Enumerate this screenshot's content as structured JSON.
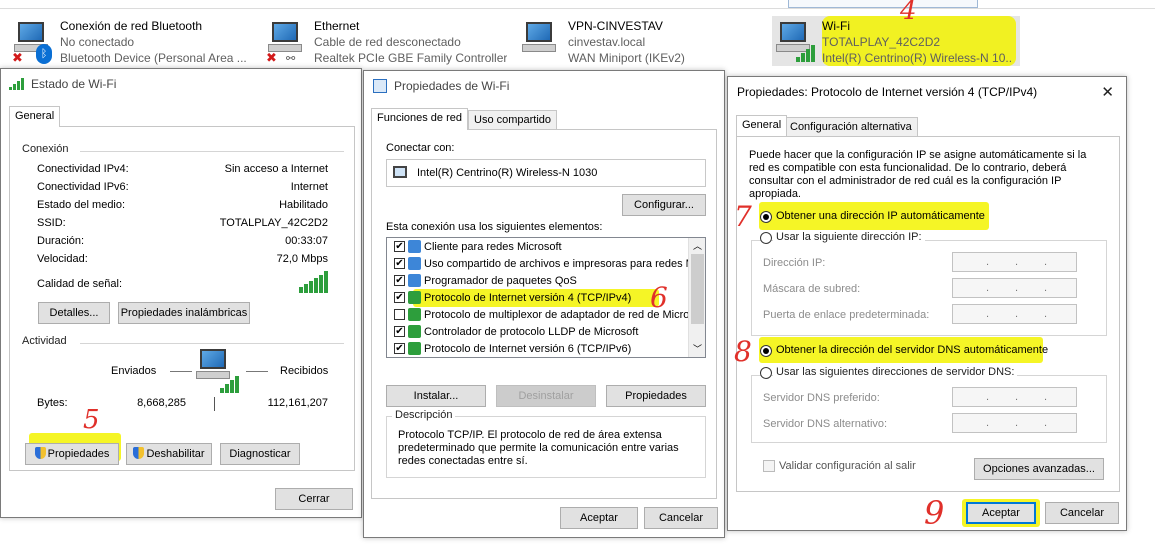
{
  "network_bar": [
    {
      "name": "Conexión de red Bluetooth",
      "line2": "No conectado",
      "line3": "Bluetooth Device (Personal Area ..."
    },
    {
      "name": "Ethernet",
      "line2": "Cable de red desconectado",
      "line3": "Realtek PCIe GBE Family Controller"
    },
    {
      "name": "VPN-CINVESTAV",
      "line2": "cinvestav.local",
      "line3": "WAN Miniport (IKEv2)"
    },
    {
      "name": "Wi-Fi",
      "line2": "TOTALPLAY_42C2D2",
      "line3": "Intel(R) Centrino(R) Wireless-N 10..."
    }
  ],
  "status_window": {
    "title": "Estado de Wi-Fi",
    "tab": "General",
    "connection_label": "Conexión",
    "rows": [
      {
        "label": "Conectividad IPv4:",
        "value": "Sin acceso a Internet"
      },
      {
        "label": "Conectividad IPv6:",
        "value": "Internet"
      },
      {
        "label": "Estado del medio:",
        "value": "Habilitado"
      },
      {
        "label": "SSID:",
        "value": "TOTALPLAY_42C2D2"
      },
      {
        "label": "Duración:",
        "value": "00:33:07"
      },
      {
        "label": "Velocidad:",
        "value": "72,0 Mbps"
      }
    ],
    "signal_label": "Calidad de señal:",
    "details_btn": "Detalles...",
    "wireless_btn": "Propiedades inalámbricas",
    "activity_label": "Actividad",
    "sent_label": "Enviados",
    "received_label": "Recibidos",
    "bytes_label": "Bytes:",
    "bytes_sent": "8,668,285",
    "bytes_received": "112,161,207",
    "properties_btn": "Propiedades",
    "disable_btn": "Deshabilitar",
    "diagnose_btn": "Diagnosticar",
    "close_btn": "Cerrar"
  },
  "props_window": {
    "title": "Propiedades de Wi-Fi",
    "tab_network": "Funciones de red",
    "tab_sharing": "Uso compartido",
    "connect_with": "Conectar con:",
    "adapter": "Intel(R) Centrino(R) Wireless-N 1030",
    "configure_btn": "Configurar...",
    "items_label": "Esta conexión usa los siguientes elementos:",
    "items": [
      {
        "label": "Cliente para redes Microsoft",
        "checked": "✔"
      },
      {
        "label": "Uso compartido de archivos e impresoras para redes M",
        "checked": "✔"
      },
      {
        "label": "Programador de paquetes QoS",
        "checked": "✔"
      },
      {
        "label": "Protocolo de Internet versión 4 (TCP/IPv4)",
        "checked": "✔"
      },
      {
        "label": "Protocolo de multiplexor de adaptador de red de Micros",
        "checked": ""
      },
      {
        "label": "Controlador de protocolo LLDP de Microsoft",
        "checked": "✔"
      },
      {
        "label": "Protocolo de Internet versión 6 (TCP/IPv6)",
        "checked": "✔"
      }
    ],
    "install_btn": "Instalar...",
    "uninstall_btn": "Desinstalar",
    "properties_btn": "Propiedades",
    "description_label": "Descripción",
    "description": "Protocolo TCP/IP. El protocolo de red de área extensa predeterminado que permite la comunicación entre varias redes conectadas entre sí.",
    "accept_btn": "Aceptar",
    "cancel_btn": "Cancelar"
  },
  "ipv4_window": {
    "title": "Propiedades: Protocolo de Internet versión 4 (TCP/IPv4)",
    "tab_general": "General",
    "tab_alt": "Configuración alternativa",
    "intro": "Puede hacer que la configuración IP se asigne automáticamente si la red es compatible con esta funcionalidad. De lo contrario, deberá consultar con el administrador de red cuál es la configuración IP apropiada.",
    "auto_ip": "Obtener una dirección IP automáticamente",
    "manual_ip": "Usar la siguiente dirección IP:",
    "ip_label": "Dirección IP:",
    "mask_label": "Máscara de subred:",
    "gateway_label": "Puerta de enlace predeterminada:",
    "auto_dns": "Obtener la dirección del servidor DNS automáticamente",
    "manual_dns": "Usar las siguientes direcciones de servidor DNS:",
    "dns1_label": "Servidor DNS preferido:",
    "dns2_label": "Servidor DNS alternativo:",
    "validate": "Validar configuración al salir",
    "advanced_btn": "Opciones avanzadas...",
    "accept_btn": "Aceptar",
    "cancel_btn": "Cancelar"
  },
  "annotations": {
    "n4": "4",
    "n5": "5",
    "n6": "6",
    "n7": "7",
    "n8": "8",
    "n9": "9"
  },
  "colors": {
    "highlight": "#f3f300",
    "annotation": "#e0302a",
    "signal": "#2d9e3c"
  }
}
